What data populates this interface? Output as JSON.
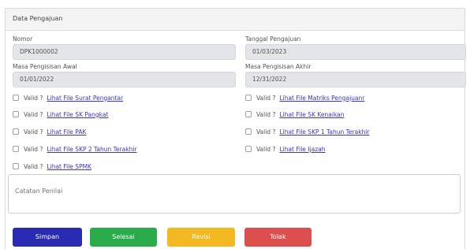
{
  "card": {
    "title": "Data Pengajuan"
  },
  "fields": {
    "nomor": {
      "label": "Nomor",
      "value": "DPK1000002"
    },
    "tanggal": {
      "label": "Tanggal Pengajuan",
      "value": "01/03/2023"
    },
    "awal": {
      "label": "Masa Pengisisan Awal",
      "value": "01/01/2022"
    },
    "akhir": {
      "label": "Masa Pengisisan Akhir",
      "value": "12/31/2022"
    }
  },
  "valid_label": "Valid ?",
  "files": [
    {
      "link": "Lihat File Surat Pengantar"
    },
    {
      "link": "Lihat File Matriks Pengajuanr"
    },
    {
      "link": "Lihat File SK Pangkat"
    },
    {
      "link": "Lihat File SK Kenaikan"
    },
    {
      "link": "Lihat File PAK"
    },
    {
      "link": "Lihat File SKP 1 Tahun Terakhir"
    },
    {
      "link": "Lihat File SKP 2 Tahun Terakhir"
    },
    {
      "link": "Lihat File Ijazah"
    },
    {
      "link": "Lihat File SPMK"
    }
  ],
  "notes": {
    "placeholder": "Catatan Penilai"
  },
  "buttons": {
    "simpan": "Simpan",
    "selesai": "Selesai",
    "revisi": "Revisi",
    "tolak": "Tolak"
  }
}
